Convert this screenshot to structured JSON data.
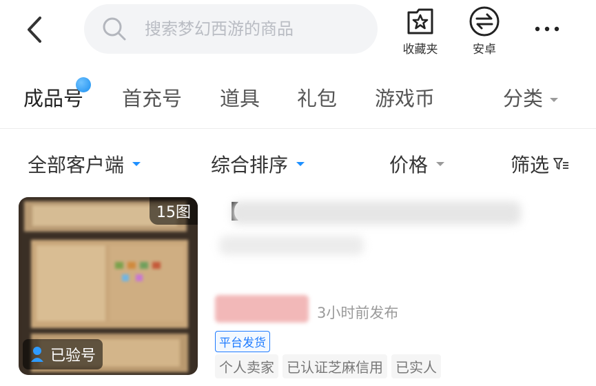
{
  "header": {
    "search_placeholder": "搜索梦幻西游的商品",
    "favorites_label": "收藏夹",
    "platform_label": "安卓"
  },
  "tabs": [
    {
      "label": "成品号",
      "active": true
    },
    {
      "label": "首充号",
      "active": false
    },
    {
      "label": "道具",
      "active": false
    },
    {
      "label": "礼包",
      "active": false
    },
    {
      "label": "游戏币",
      "active": false
    },
    {
      "label": "分类",
      "active": false
    }
  ],
  "filters": {
    "client": "全部客户端",
    "sort": "综合排序",
    "price": "价格",
    "screen": "筛选"
  },
  "listing": {
    "image_count": "15图",
    "verified_label": "已验号",
    "title_prefix": "【",
    "posted_time": "3小时前发布",
    "delivery_tag": "平台发货",
    "seller_tags": [
      "个人卖家",
      "已认证芝麻信用",
      "已实人"
    ]
  },
  "colors": {
    "accent": "#1e90ff",
    "badge": "#1c8ff0",
    "price_blur": "#f2b8b8"
  }
}
